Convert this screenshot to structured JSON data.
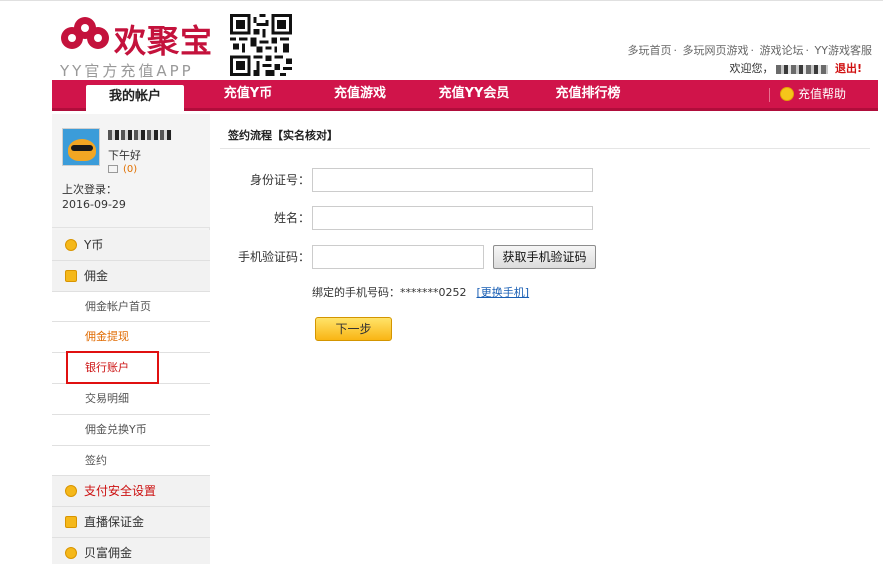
{
  "header": {
    "brand_name": "欢聚宝",
    "brand_sub": "YY官方充值APP",
    "top_links": [
      "多玩首页",
      "多玩网页游戏",
      "游戏论坛",
      "YY游戏客服"
    ],
    "welcome_label": "欢迎您，",
    "logout_label": "退出!"
  },
  "nav": {
    "items": [
      "我的帐户",
      "充值Y币",
      "充值游戏",
      "充值YY会员",
      "充值排行榜"
    ],
    "active": "我的帐户",
    "help_label": "充值帮助"
  },
  "profile": {
    "greeting": "下午好",
    "message_count": "(0)",
    "last_login_label": "上次登录：",
    "last_login_date": "2016-09-29"
  },
  "sidebar": {
    "items": [
      {
        "label": "Y币",
        "level": 1,
        "icon": "coin-icon"
      },
      {
        "label": "佣金",
        "level": 1,
        "icon": "money-bag-icon"
      },
      {
        "label": "佣金帐户首页",
        "level": 2
      },
      {
        "label": "佣金提现",
        "level": 2,
        "state": "current-section"
      },
      {
        "label": "银行账户",
        "level": 2,
        "state": "highlighted"
      },
      {
        "label": "交易明细",
        "level": 2
      },
      {
        "label": "佣金兑换Y币",
        "level": 2
      },
      {
        "label": "签约",
        "level": 2
      },
      {
        "label": "支付安全设置",
        "level": 1,
        "icon": "security-icon"
      },
      {
        "label": "直播保证金",
        "level": 1,
        "icon": "play-icon"
      },
      {
        "label": "贝富佣金",
        "level": 1,
        "icon": "coin-icon"
      }
    ]
  },
  "main": {
    "title": "签约流程【实名核对】",
    "fields": {
      "id_label": "身份证号：",
      "id_value": "",
      "name_label": "姓名：",
      "name_value": "",
      "code_label": "手机验证码：",
      "code_value": ""
    },
    "get_code_button": "获取手机验证码",
    "bound_phone_label": "绑定的手机号码：",
    "bound_phone_value": "*******0252",
    "change_phone_link": "[更换手机]",
    "next_button": "下一步"
  },
  "colors": {
    "nav_bg": "#d0144a",
    "brand_red": "#c4123c",
    "highlight_border": "#e01010",
    "next_button": "#f9b514",
    "link": "#1a5fb4"
  }
}
